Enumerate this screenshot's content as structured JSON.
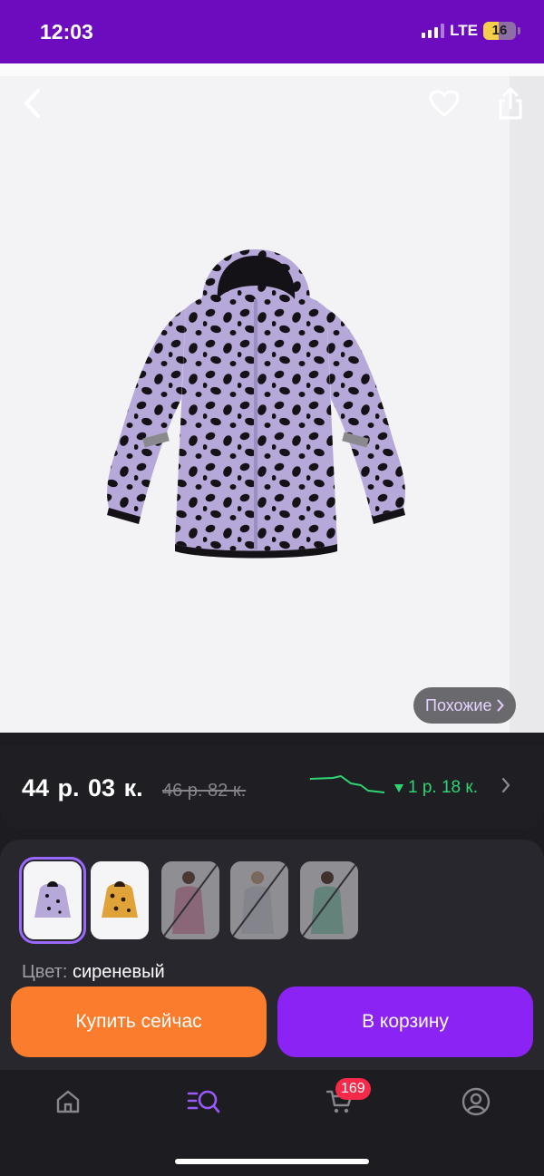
{
  "status_bar": {
    "time": "12:03",
    "network": "LTE",
    "battery_level": "16"
  },
  "product": {
    "image_icon": "lilac-spotted-hooded-jacket",
    "similar_label": "Похожие",
    "price": {
      "current": "44 р. 03 к.",
      "old": "46 р. 82 к.",
      "drop": "1 р. 18 к.",
      "drop_color": "#2ed573"
    },
    "variants": [
      {
        "name": "lilac-jacket",
        "selected": true,
        "available": true
      },
      {
        "name": "leopard-jacket",
        "selected": false,
        "available": true
      },
      {
        "name": "pink-jacket-model",
        "selected": false,
        "available": false
      },
      {
        "name": "white-jacket-model",
        "selected": false,
        "available": false
      },
      {
        "name": "mint-jacket-model",
        "selected": false,
        "available": false
      }
    ],
    "color_label": "Цвет:",
    "color_value": "сиреневый"
  },
  "actions": {
    "buy_now": "Купить сейчас",
    "add_to_cart": "В корзину"
  },
  "tab_bar": {
    "cart_count": "169",
    "active_tab": "catalog"
  },
  "colors": {
    "brand_purple": "#6d0bbf",
    "buy_orange": "#fb7c2c",
    "cart_purple": "#8b23f4",
    "badge_red": "#f5294a"
  }
}
